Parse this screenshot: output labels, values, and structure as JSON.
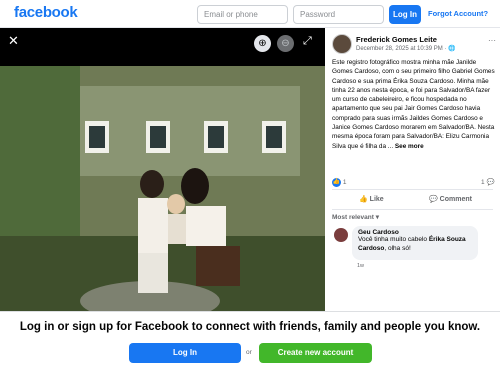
{
  "header": {
    "logo": "facebook",
    "email_placeholder": "Email or phone",
    "password_placeholder": "Password",
    "login_label": "Log In",
    "forgot_label": "Forgot Account?"
  },
  "viewer": {
    "close_icon": "✕",
    "zoom_in_icon": "⊕",
    "zoom_out_icon": "⊖",
    "expand_icon": "⤢"
  },
  "post": {
    "author": "Frederick Gomes Leite",
    "date": "December 28, 2025 at 10:39 PM · ",
    "privacy_icon": "🌐",
    "more_icon": "···",
    "text": "Este registro fotográfico mostra minha mãe Janilde Gomes Cardoso, com o seu primeiro filho Gabriel Gomes Cardoso e sua prima Érika Souza Cardoso. Minha mãe tinha 22 anos nesta época, e foi para Salvador/BA fazer um curso de cabeleireiro, e ficou hospedada no apartamento que seu pai Jair Gomes Cardoso havia comprado para suas irmãs Jaildes Gomes Cardoso e Janice Gomes Cardoso morarem em Salvador/BA. Nesta mesma época foram para Salvador/BA: Elizu Carmonia Silva que é filha da ...",
    "see_more": "See more",
    "reaction_count": "1",
    "comment_count": "1",
    "like_label": "Like",
    "comment_label": "Comment",
    "sort_label": "Most relevant"
  },
  "comment": {
    "author": "Geu Cardoso",
    "text_prefix": "Você tinha muito cabelo ",
    "mention": "Érika Souza Cardoso",
    "text_suffix": ", olha só!",
    "time": "1w"
  },
  "footer": {
    "heading": "Log in or sign up for Facebook to connect with friends, family and people you know.",
    "login_label": "Log In",
    "or_label": "or",
    "create_label": "Create new account"
  },
  "colors": {
    "brand": "#1877f2",
    "create": "#42b72a"
  }
}
